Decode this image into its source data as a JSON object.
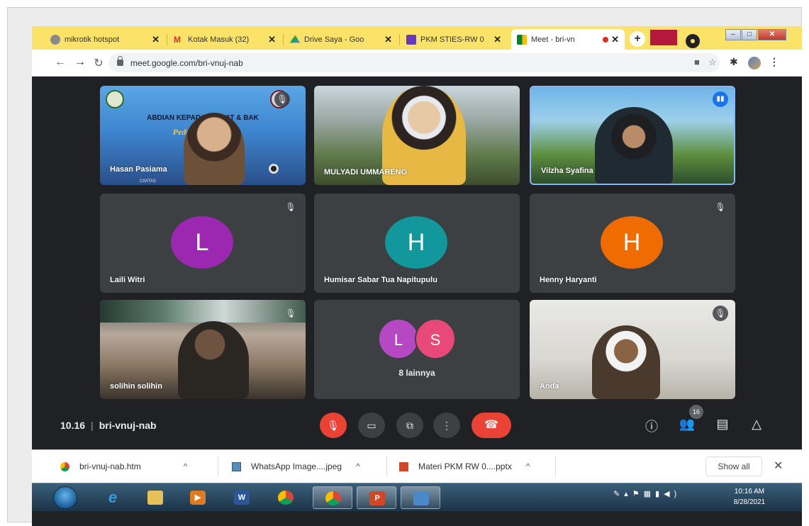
{
  "browser": {
    "tabs": [
      {
        "title": "mikrotik hotspot",
        "favicon": "hotspot-icon",
        "color": "#7a7a7a"
      },
      {
        "title": "Kotak Masuk (32)",
        "favicon": "gmail-icon",
        "color": "#d93025"
      },
      {
        "title": "Drive Saya - Goo",
        "favicon": "drive-icon",
        "color": "#1fa463"
      },
      {
        "title": "PKM STIES-RW 0",
        "favicon": "forms-icon",
        "color": "#673ab7"
      },
      {
        "title": "Meet - bri-vn",
        "favicon": "meet-icon",
        "color": "#00832d"
      }
    ],
    "new_tab": "+",
    "url": "meet.google.com/bri-vnuj-nab"
  },
  "meet": {
    "tiles": [
      {
        "name": "Hasan Pasiama",
        "banner": "ABDIAN KEPADA M        AKAT & BAK",
        "banner2": "Peduli Dan      id-19",
        "sub": "CIVITAS"
      },
      {
        "name": "MULYADI UMMARENG"
      },
      {
        "name": "Vilzha Syafina"
      },
      {
        "name": "Laili Witri",
        "initial": "L",
        "color": "#9c27b0"
      },
      {
        "name": "Humisar Sabar Tua Napitupulu",
        "initial": "H",
        "color": "#12979c"
      },
      {
        "name": "Henny Haryanti",
        "initial": "H",
        "color": "#ef6c00"
      },
      {
        "name": "solihin solihin"
      },
      {
        "others_label": "8 lainnya",
        "initials": [
          "L",
          "S"
        ],
        "colors": [
          "#b648c4",
          "#e8497a"
        ]
      },
      {
        "name": "Anda"
      }
    ],
    "time": "10.16",
    "meeting_code": "bri-vnuj-nab",
    "participant_count": "16"
  },
  "downloads": {
    "items": [
      {
        "name": "bri-vnuj-nab.htm",
        "icon": "chrome-file-icon"
      },
      {
        "name": "WhatsApp Image....jpeg",
        "icon": "image-file-icon"
      },
      {
        "name": "Materi PKM RW 0....pptx",
        "icon": "pptx-file-icon"
      }
    ],
    "show_all": "Show all"
  },
  "taskbar": {
    "time": "10:16 AM",
    "date": "8/28/2021"
  }
}
